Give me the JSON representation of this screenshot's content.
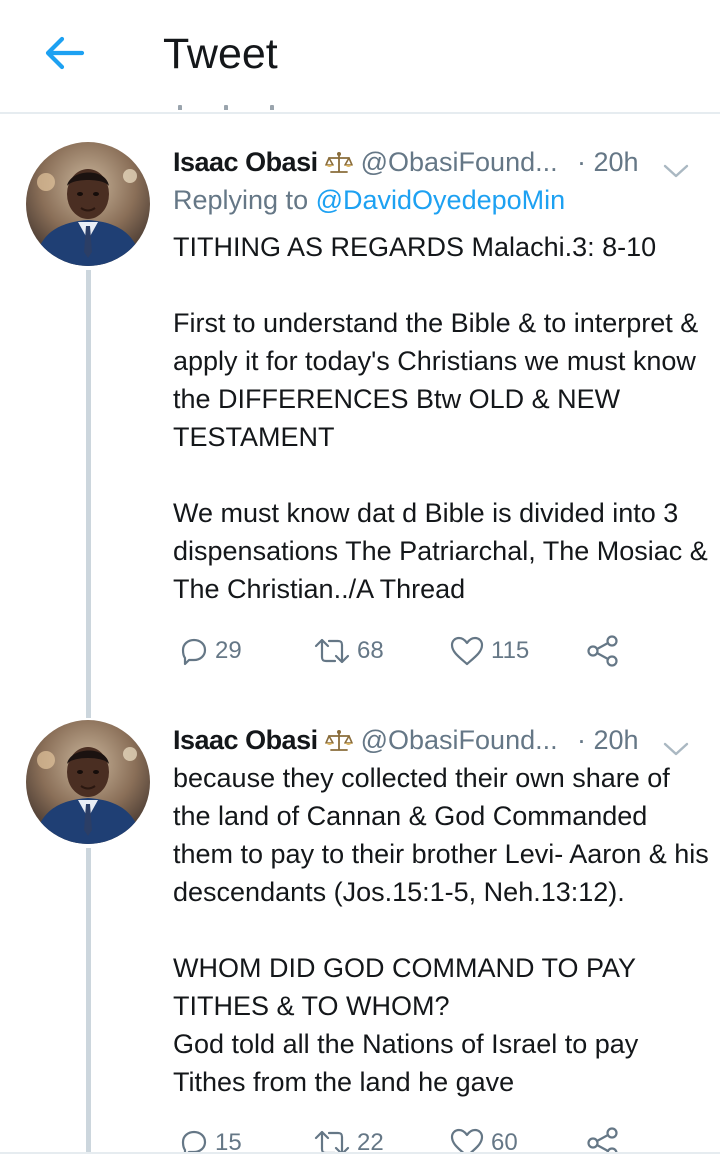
{
  "header": {
    "title": "Tweet",
    "back_icon": "arrow-left-icon",
    "accent_color": "#1da1f2"
  },
  "tweets": [
    {
      "author_name": "Isaac Obasi",
      "badge_icon": "scales-icon",
      "handle": "@ObasiFound...",
      "time": "· 20h",
      "reply_prefix": "Replying to",
      "reply_to": "@DavidOyedepoMin",
      "paragraphs": [
        "TITHING AS REGARDS Malachi.3: 8-10",
        "First to understand the Bible & to interpret & apply it for today's Christians we must know the DIFFERENCES Btw OLD & NEW TESTAMENT",
        "We must know dat d Bible is divided into 3 dispensations The Patriarchal, The Mosiac & The Christian../A Thread"
      ],
      "replies": "29",
      "retweets": "68",
      "likes": "115"
    },
    {
      "author_name": "Isaac Obasi",
      "badge_icon": "scales-icon",
      "handle": "@ObasiFound...",
      "time": "· 20h",
      "paragraphs": [
        "because they collected their own share of the land of Cannan & God Commanded them to pay to their brother Levi- Aaron & his descendants (Jos.15:1-5, Neh.13:12).",
        "WHOM DID GOD COMMAND TO PAY TITHES & TO WHOM?\nGod told all the Nations of Israel to pay Tithes from the land he gave"
      ],
      "replies": "15",
      "retweets": "22",
      "likes": "60"
    }
  ]
}
